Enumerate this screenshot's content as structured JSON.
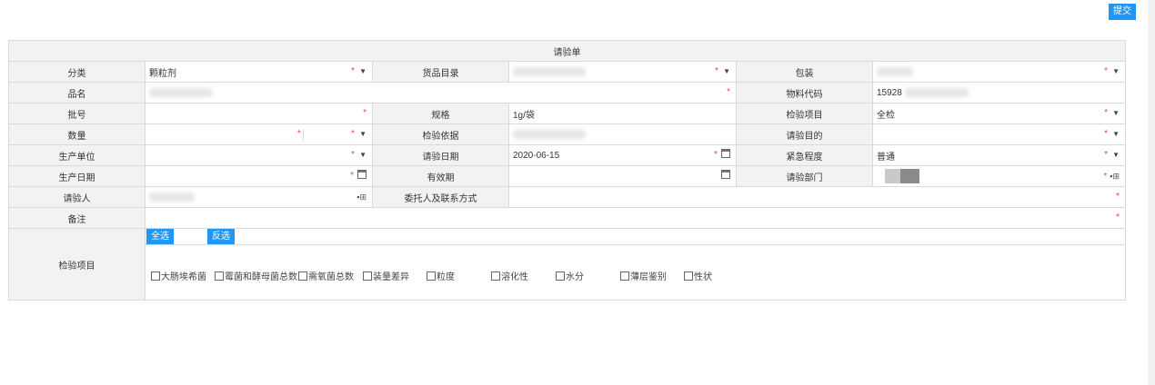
{
  "toolbar": {
    "submit_label": "提交"
  },
  "form": {
    "title": "请验单",
    "labels": {
      "category": "分类",
      "catalog": "货品目录",
      "package": "包装",
      "name": "品名",
      "material_code": "物料代码",
      "batch": "批号",
      "spec": "规格",
      "inspect_item": "检验项目",
      "quantity": "数量",
      "basis": "检验依据",
      "purpose": "请验目的",
      "producer": "生产单位",
      "request_date": "请验日期",
      "urgency": "紧急程度",
      "prod_date": "生产日期",
      "expiry": "有效期",
      "dept": "请验部门",
      "requester": "请验人",
      "entrust": "委托人及联系方式",
      "remark": "备注",
      "check_items": "检验项目"
    },
    "values": {
      "category": "颗粒剂",
      "material_code": "15928",
      "spec": "1g/袋",
      "inspect_item": "全检",
      "request_date": "2020-06-15",
      "urgency": "普通"
    },
    "required_mark": "*",
    "select_all": "全选",
    "invert": "反选",
    "checkbox_items": [
      "大肠埃希菌",
      "霉菌和酵母菌总数",
      "需氧菌总数",
      "装量差异",
      "粒度",
      "溶化性",
      "水分",
      "薄层鉴别",
      "性状"
    ]
  }
}
